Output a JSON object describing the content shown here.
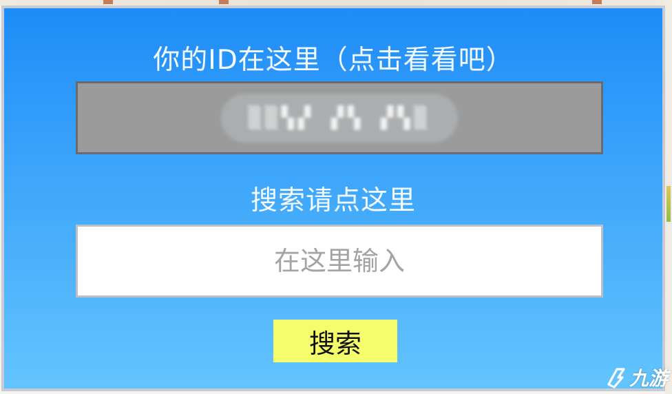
{
  "panel": {
    "id_title": "你的ID在这里（点击看看吧）",
    "id_value": "▒▒▚▞ ▞▚ ▞▚▒",
    "search_title": "搜索请点这里",
    "search_placeholder": "在这里输入",
    "search_button_label": "搜索"
  },
  "watermark": {
    "text": "九游",
    "icon": "jiuyou-logo-icon"
  },
  "colors": {
    "panel_top": "#1e8cf8",
    "panel_bottom": "#63c4fd",
    "id_box": "#9b9b9b",
    "button": "#f4fd6b"
  }
}
